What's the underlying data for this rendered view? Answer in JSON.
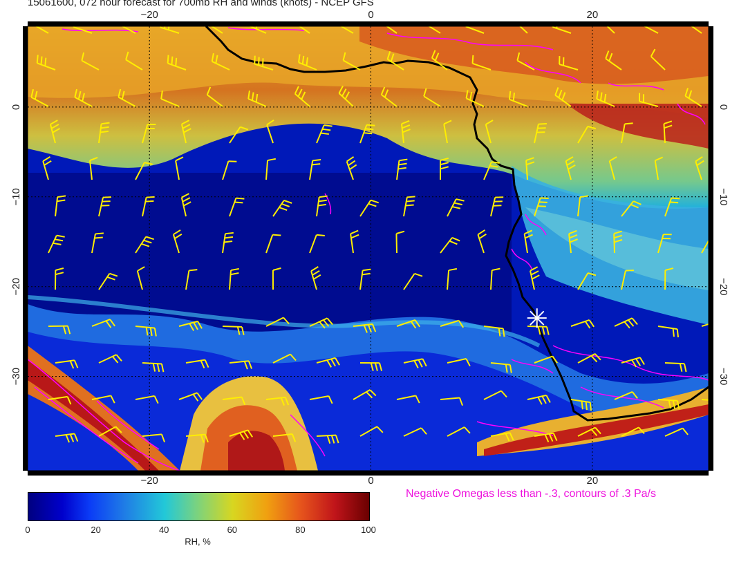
{
  "title": "15061600, 072 hour forecast for 700mb RH and winds (knots) - NCEP GFS",
  "caption": "Negative Omegas less than -.3, contours of .3 Pa/s",
  "map": {
    "lon_range": [
      -31,
      30.5
    ],
    "lat_range": [
      -40.5,
      9
    ],
    "gridlines_lon": [
      -20,
      0,
      20
    ],
    "gridlines_lat": [
      0,
      -10,
      -20,
      -30
    ],
    "lon_tick_labels": [
      "−20",
      "0",
      "20"
    ],
    "lat_tick_labels": [
      "0",
      "−10",
      "−20",
      "−30"
    ],
    "site_marker_lonlat": [
      15,
      -23.5
    ],
    "marker_symbol": "asterisk",
    "coastline_color": "#000000",
    "wind_barb_color": "#ffee00",
    "omega_contour_color": "#ff00ff"
  },
  "colorbar": {
    "label": "RH, %",
    "ticks": [
      "0",
      "20",
      "40",
      "60",
      "80",
      "100"
    ],
    "range": [
      0,
      100
    ],
    "colors": [
      "#000080",
      "#0000cc",
      "#0b3cf6",
      "#1f7be6",
      "#22c8d8",
      "#7fd37a",
      "#d8d620",
      "#f0a010",
      "#e6541c",
      "#c0141a",
      "#6a0000"
    ]
  }
}
